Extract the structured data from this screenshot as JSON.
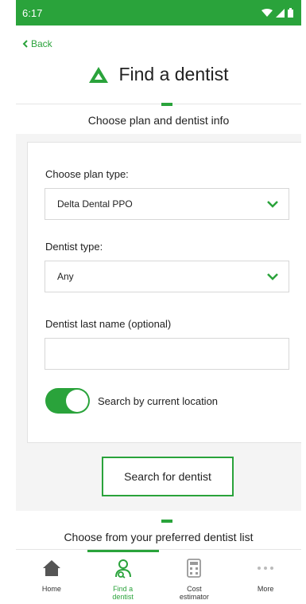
{
  "status_bar": {
    "time": "6:17"
  },
  "header": {
    "back_label": "Back",
    "title": "Find a dentist"
  },
  "section1": {
    "title": "Choose plan and dentist info"
  },
  "form": {
    "plan_type_label": "Choose plan type:",
    "plan_type_value": "Delta Dental PPO",
    "dentist_type_label": "Dentist type:",
    "dentist_type_value": "Any",
    "last_name_label": "Dentist last name (optional)",
    "last_name_value": "",
    "location_toggle_label": "Search by current location",
    "location_toggle_on": true
  },
  "search_button_label": "Search for dentist",
  "section2": {
    "title": "Choose from your preferred dentist list"
  },
  "bottom_nav": {
    "items": [
      {
        "label": "Home",
        "icon": "home-icon"
      },
      {
        "label": "Find a dentist",
        "icon": "find-dentist-icon"
      },
      {
        "label": "Cost estimator",
        "icon": "calculator-icon"
      },
      {
        "label": "More",
        "icon": "more-icon"
      }
    ]
  },
  "colors": {
    "accent": "#2aa33b",
    "background": "#f4f4f4"
  }
}
